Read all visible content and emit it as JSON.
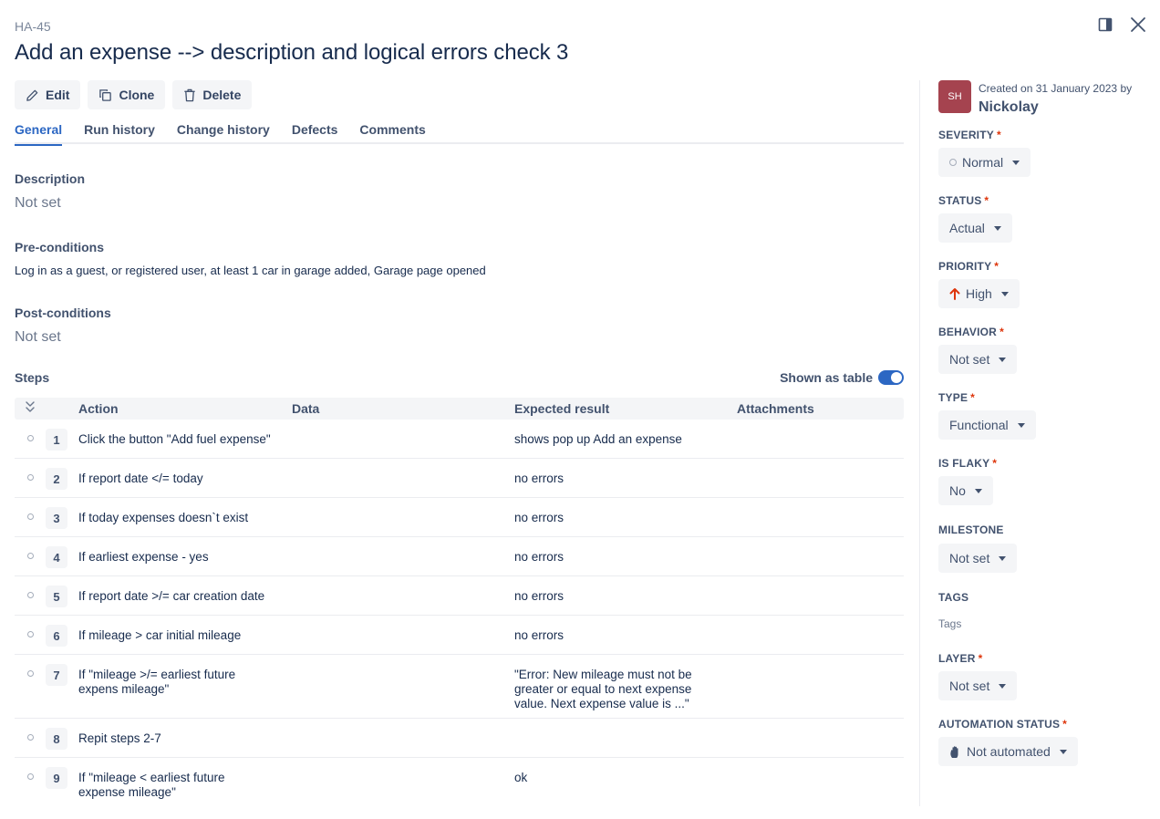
{
  "header": {
    "case_key": "HA-45",
    "title": "Add an expense --> description and logical errors check 3"
  },
  "toolbar": {
    "edit_label": "Edit",
    "clone_label": "Clone",
    "delete_label": "Delete"
  },
  "tabs": [
    {
      "label": "General",
      "active": true
    },
    {
      "label": "Run history",
      "active": false
    },
    {
      "label": "Change history",
      "active": false
    },
    {
      "label": "Defects",
      "active": false
    },
    {
      "label": "Comments",
      "active": false
    }
  ],
  "general": {
    "description_label": "Description",
    "description_value": "Not set",
    "preconditions_label": "Pre-conditions",
    "preconditions_value": "Log in as a guest, or registered user, at least 1 car in garage added, Garage page opened",
    "postconditions_label": "Post-conditions",
    "postconditions_value": "Not set",
    "steps_label": "Steps",
    "shown_as_table_label": "Shown as table",
    "shown_as_table_on": true
  },
  "steps_table": {
    "columns": {
      "action": "Action",
      "data": "Data",
      "expected": "Expected result",
      "attachments": "Attachments"
    },
    "rows": [
      {
        "num": "1",
        "action": "Click the button \"Add fuel expense\"",
        "expected": "shows pop up Add an expense"
      },
      {
        "num": "2",
        "action": "If report date </= today",
        "expected": "no errors"
      },
      {
        "num": "3",
        "action": "If today expenses doesn`t exist",
        "expected": "no errors"
      },
      {
        "num": "4",
        "action": "If earliest expense - yes",
        "expected": "no errors"
      },
      {
        "num": "5",
        "action": "If report date >/= car creation date",
        "expected": "no errors"
      },
      {
        "num": "6",
        "action": "If mileage > car initial mileage",
        "expected": "no errors"
      },
      {
        "num": "7",
        "action": "If \"mileage >/= earliest future expens mileage\"",
        "expected": "\"Error: New mileage must not be greater or equal to next expense value. Next expense value is ...\""
      },
      {
        "num": "8",
        "action": "Repit steps 2-7",
        "expected": ""
      },
      {
        "num": "9",
        "action": "If \"mileage < earliest future expense mileage\"",
        "expected": "ok"
      }
    ]
  },
  "sidebar": {
    "avatar_initials": "SH",
    "created_text": "Created on 31 January 2023 by",
    "creator_name": "Nickolay",
    "fields": {
      "severity": {
        "label": "SEVERITY",
        "value": "Normal"
      },
      "status": {
        "label": "STATUS",
        "value": "Actual"
      },
      "priority": {
        "label": "PRIORITY",
        "value": "High"
      },
      "behavior": {
        "label": "BEHAVIOR",
        "value": "Not set"
      },
      "type": {
        "label": "TYPE",
        "value": "Functional"
      },
      "is_flaky": {
        "label": "IS FLAKY",
        "value": "No"
      },
      "milestone": {
        "label": "MILESTONE",
        "value": "Not set"
      },
      "tags": {
        "label": "TAGS",
        "value": "Tags"
      },
      "layer": {
        "label": "LAYER",
        "value": "Not set"
      },
      "automation_status": {
        "label": "AUTOMATION STATUS",
        "value": "Not automated"
      }
    },
    "required_marker": "*"
  },
  "colors": {
    "accent": "#2c67c3",
    "priority_high": "#de350b",
    "avatar_bg": "#a5434f"
  }
}
